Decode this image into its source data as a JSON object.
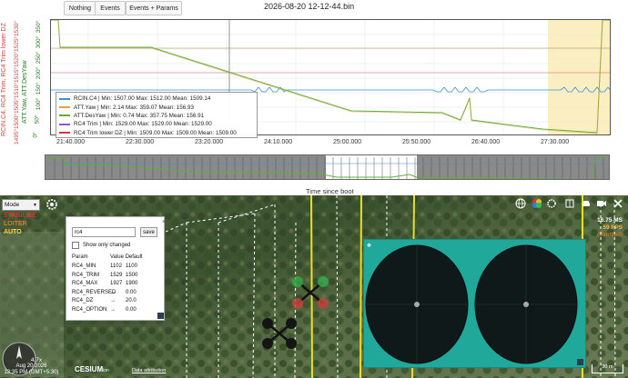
{
  "toolbar": {
    "buttons": [
      {
        "label": "Nothing"
      },
      {
        "label": "Events"
      },
      {
        "label": "Events + Params"
      }
    ]
  },
  "plot": {
    "title": "2026-08-20 12-12-44.bin",
    "x_label": "Time since boot",
    "x_ticks": [
      "21:40.000",
      "22:30.000",
      "23:20.000",
      "24:10.000",
      "25:00.000",
      "25:50.000",
      "26:40.000",
      "27:30.000"
    ],
    "y_ticks_green": [
      "350°",
      "300°",
      "250°",
      "200°",
      "150°",
      "100°",
      "50°",
      "0°"
    ],
    "y_ticks_red": [
      "1530°",
      "1525°",
      "1520°",
      "1515°",
      "1510°",
      "1505°",
      "1500°",
      "1495°"
    ],
    "y_label_left": "RCIN.C4, RC4 Trim, RC4 Trim lower DZ",
    "y_label_right": "ATT.Yaw, ATT.DesYaw",
    "legend": [
      {
        "text": "RCIN.C4 | Min: 1507.00     Max: 1512.00     Mean: 1509.14",
        "color": "#3a8fd6"
      },
      {
        "text": "ATT.Yaw | Min: 2.14      Max: 359.07     Mean: 156.93",
        "color": "#e8a23a"
      },
      {
        "text": "ATT.DesYaw | Min: 0.74     Max: 357.75     Mean: 156.91",
        "color": "#5fae3a"
      },
      {
        "text": "RC4 Trim | Min: 1529.00     Max: 1529.00     Mean: 1529.00",
        "color": "#8e5ac8"
      },
      {
        "text": "RC4 Trim lower DZ | Min: 1509.00     Max: 1509.00     Mean: 1509.00",
        "color": "#d43a3a"
      }
    ]
  },
  "map": {
    "mode_select": {
      "value": "Mode"
    },
    "modes": [
      {
        "label": "STABILIZE",
        "color": "#e03030"
      },
      {
        "label": "LOITER",
        "color": "#e07a30"
      },
      {
        "label": "AUTO",
        "color": "#ffd24a"
      }
    ],
    "param_panel": {
      "search_value": "rc4",
      "save_label": "save",
      "show_changed_label": "Show only changed",
      "header": {
        "param": "Param",
        "value": "Value",
        "default": "Default"
      },
      "rows": [
        {
          "name": "RC4_MIN",
          "value": "1102",
          "default": "1100"
        },
        {
          "name": "RC4_TRIM",
          "value": "1529",
          "default": "1500"
        },
        {
          "name": "RC4_MAX",
          "value": "1927",
          "default": "1900"
        },
        {
          "name": "RC4_REVERSED",
          "value": "→",
          "default": "0.00"
        },
        {
          "name": "RC4_DZ",
          "value": "→",
          "default": "20.0"
        },
        {
          "name": "RC4_OPTION",
          "value": "→",
          "default": "0.00"
        }
      ],
      "close_glyph": "×"
    },
    "stats": {
      "ms": "16.75 MS",
      "fps": "59 FPS",
      "throttled": "(throttled)"
    },
    "zoom": "4.7x",
    "date": "Aug 20 2026",
    "time": "12:35 PM (GMT+5:30)",
    "cesium": "CESIUM",
    "cesium_suffix": "ion",
    "attribution": "Data attribution",
    "scale": "30 m",
    "colors": {
      "video_panel": "#20a89a",
      "track_yellow": "#e8e020"
    }
  }
}
